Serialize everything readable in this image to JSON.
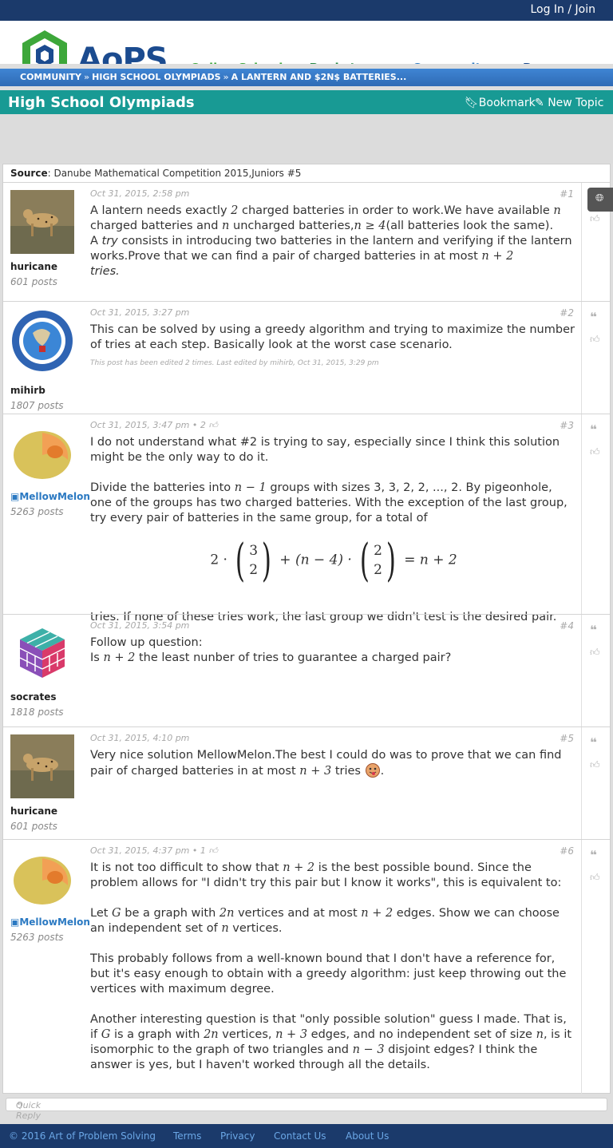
{
  "topbar": {
    "login": "Log In / Join"
  },
  "header": {
    "logo_text": "AoPS",
    "nav": [
      "Online School",
      "Bookstore",
      "Community",
      "Resources"
    ]
  },
  "breadcrumb": [
    "COMMUNITY",
    "HIGH SCHOOL OLYMPIADS",
    "A LANTERN AND $2N$ BATTERIES..."
  ],
  "breadcrumb_sep": "»",
  "forum": {
    "title": "High School Olympiads",
    "bookmark": "Bookmark",
    "new_topic": "New Topic"
  },
  "source": {
    "label": "Source",
    "text": ": Danube Mathematical Competition 2015,Juniors #5"
  },
  "posts": [
    {
      "meta": "Oct 31, 2015, 2:58 pm",
      "num": "#1",
      "user": "huricane",
      "post_count": "601 posts",
      "avatar": "cheetah",
      "p1a": "A lantern needs exactly ",
      "m1": "2",
      "p1b": " charged batteries in order to work.We have available ",
      "m2": "n",
      "p1c": " charged batteries and ",
      "m3": "n",
      "p1d": " uncharged batteries,",
      "m4": "n ≥ 4",
      "p1e": "(all batteries look the same).",
      "p2a": "A ",
      "p2try": "try",
      "p2b": " consists in introducing two batteries in the lantern and verifying if the lantern works.Prove that we can find a pair of charged batteries in at most ",
      "m5": "n + 2",
      "p2c": "tries."
    },
    {
      "meta": "Oct 31, 2015, 3:27 pm",
      "num": "#2",
      "user": "mihirb",
      "post_count": "1807 posts",
      "avatar": "national-geographic-bee",
      "text": "This can be solved by using a greedy algorithm and trying to maximize the number of tries at each step. Basically look at the worst case scenario.",
      "edit": "This post has been edited 2 times. Last edited by mihirb, Oct 31, 2015, 3:29 pm"
    },
    {
      "meta": "Oct 31, 2015, 3:47 pm • 2",
      "num": "#3",
      "user": "MellowMelon",
      "post_count": "5263 posts",
      "avatar": "melon",
      "p1": "I do not understand what #2 is trying to say, especially since I think this solution might be the only way to do it.",
      "p2a": "Divide the batteries into ",
      "m1": "n − 1",
      "p2b": " groups with sizes 3, 3, 2, 2, ..., 2. By pigeonhole, one of the groups has two charged batteries. With the exception of the last group, try every pair of batteries in the same group, for a total of",
      "eq_a": "2 ·",
      "eq_b1": "3",
      "eq_b2": "2",
      "eq_c": "+ (n − 4) ·",
      "eq_d1": "2",
      "eq_d2": "2",
      "eq_e": "= n + 2",
      "p3": "tries. If none of these tries work, the last group we didn't test is the desired pair."
    },
    {
      "meta": "Oct 31, 2015, 3:54 pm",
      "num": "#4",
      "user": "socrates",
      "post_count": "1818 posts",
      "avatar": "cube",
      "p1": "Follow up question:",
      "p2a": "Is ",
      "m1": "n + 2",
      "p2b": " the least nunber of tries to guarantee a charged pair?"
    },
    {
      "meta": "Oct 31, 2015, 4:10 pm",
      "num": "#5",
      "user": "huricane",
      "post_count": "601 posts",
      "avatar": "cheetah",
      "pa": "Very nice solution MellowMelon.The best I could do was to prove that we can find pair of charged batteries in at most ",
      "m1": "n + 3",
      "pb": " tries ",
      "pc": "."
    },
    {
      "meta": "Oct 31, 2015, 4:37 pm • 1",
      "num": "#6",
      "user": "MellowMelon",
      "post_count": "5263 posts",
      "avatar": "melon",
      "p1a": "It is not too difficult to show that ",
      "m1": "n + 2",
      "p1b": " is the best possible bound. Since the problem allows for \"I didn't try this pair but I know it works\", this is equivalent to:",
      "p2a": "Let ",
      "m2": "G",
      "p2b": " be a graph with ",
      "m3": "2n",
      "p2c": " vertices and at most ",
      "m4": "n + 2",
      "p2d": " edges. Show we can choose an independent set of ",
      "m5": "n",
      "p2e": " vertices.",
      "p3": "This probably follows from a well-known bound that I don't have a reference for, but it's easy enough to obtain with a greedy algorithm: just keep throwing out the vertices with maximum degree.",
      "p4a": "Another interesting question is that \"only possible solution\" guess I made. That is, if ",
      "m6": "G",
      "p4b": " is a graph with ",
      "m7": "2n",
      "p4c": " vertices, ",
      "m8": "n + 3",
      "p4d": " edges, and no independent set of size ",
      "m9": "n",
      "p4e": ", is it isomorphic to the graph of two triangles and ",
      "m10": "n − 3",
      "p4f": " disjoint edges? I think the answer is yes, but I haven't worked through all the details."
    }
  ],
  "quick_reply": "Quick Reply",
  "footer": {
    "copyright": "© 2016 Art of Problem Solving",
    "links": [
      "Terms",
      "Privacy",
      "Contact Us",
      "About Us"
    ]
  },
  "colors": {
    "topbar": "#1b3a6b",
    "teal": "#189a94",
    "blue": "#2b79c2",
    "green": "#3da73a"
  }
}
